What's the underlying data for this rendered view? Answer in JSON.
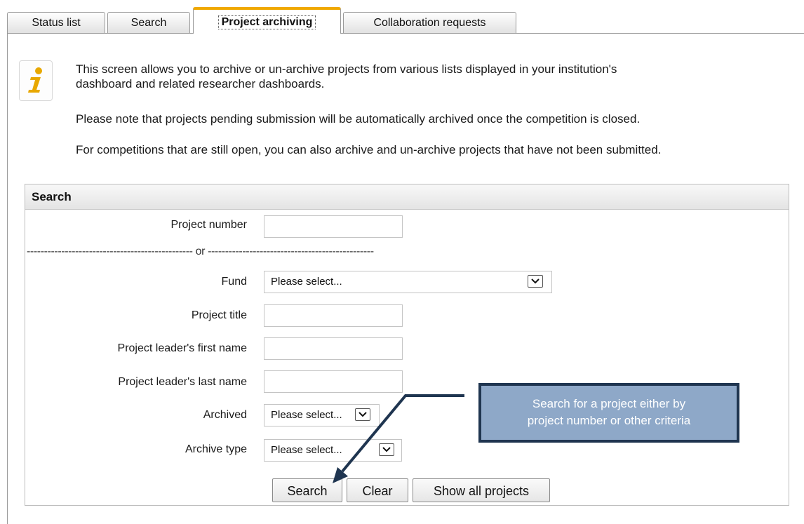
{
  "tabs": [
    {
      "label": "Status list",
      "active": false
    },
    {
      "label": "Search",
      "active": false
    },
    {
      "label": "Project archiving",
      "active": true
    },
    {
      "label": "Collaboration requests",
      "active": false
    }
  ],
  "info": {
    "icon": "info-icon",
    "paragraphs": [
      "This screen allows you to archive or un-archive projects from various lists displayed in your institution's",
      "dashboard and related researcher dashboards.",
      "Please note that projects pending submission will be automatically archived once the competition is closed.",
      "For competitions that are still open, you can also archive and un-archive projects that have not been submitted."
    ]
  },
  "search": {
    "title": "Search",
    "divider": "------------------------------------------------ or ------------------------------------------------",
    "fields": {
      "project_number": {
        "label": "Project number",
        "value": ""
      },
      "fund": {
        "label": "Fund",
        "value": "Please select..."
      },
      "project_title": {
        "label": "Project title",
        "value": ""
      },
      "leader_first": {
        "label": "Project leader's first name",
        "value": ""
      },
      "leader_last": {
        "label": "Project leader's last name",
        "value": ""
      },
      "archived": {
        "label": "Archived",
        "value": "Please select..."
      },
      "archive_type": {
        "label": "Archive type",
        "value": "Please select..."
      }
    },
    "buttons": {
      "search": "Search",
      "clear": "Clear",
      "show_all": "Show all projects"
    }
  },
  "callout": {
    "line1": "Search for a project either by",
    "line2": "project number or other criteria",
    "fill_color": "#8ea8c8",
    "border_color": "#1f3550"
  },
  "colors": {
    "active_tab_accent": "#f0a800",
    "info_icon": "#e8a800"
  }
}
